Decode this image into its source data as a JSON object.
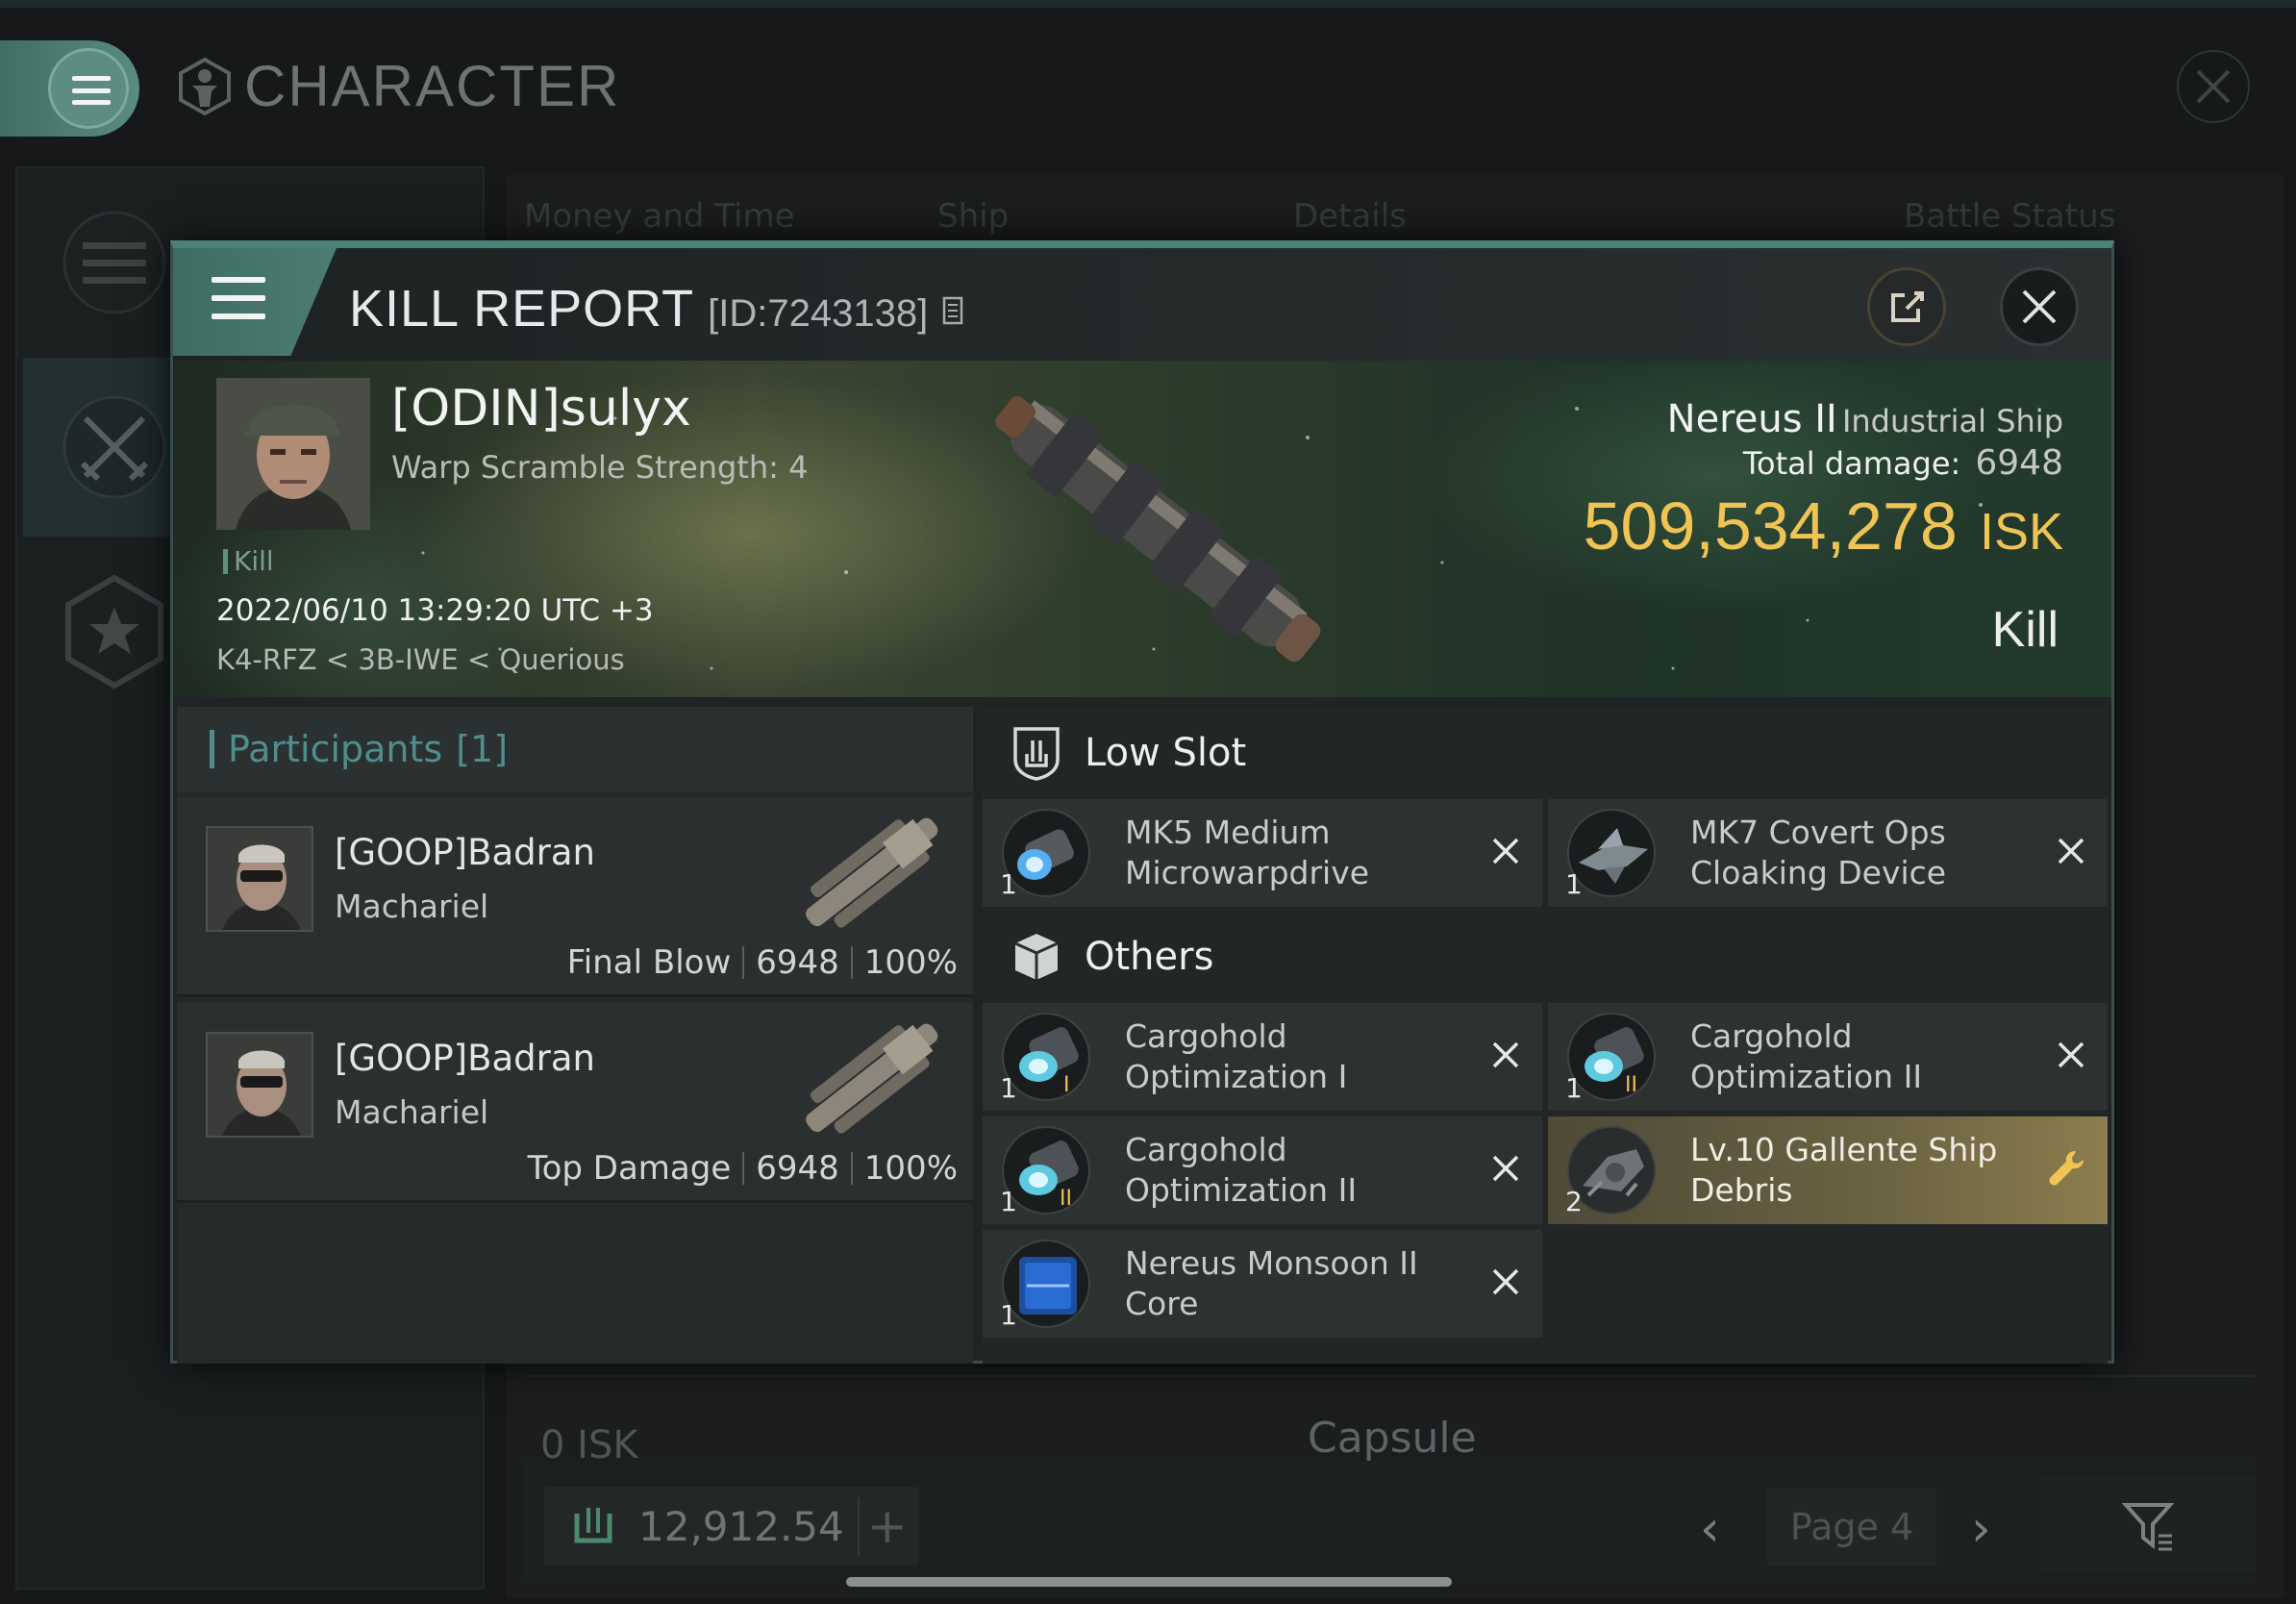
{
  "background_window": {
    "title": "CHARACTER",
    "tabs": [
      "Money and Time",
      "Ship",
      "Details",
      "Battle Status"
    ],
    "row_isk": "0 ISK",
    "row_ship": "Capsule",
    "balance": "12,912.54",
    "page": "Page 4"
  },
  "kill_report": {
    "title": "KILL REPORT",
    "report_id": "[ID:7243138]",
    "victim": {
      "name": "[ODIN]sulyx",
      "subtitle": "Warp Scramble Strength: 4",
      "tag": "Kill",
      "datetime": "2022/06/10 13:29:20 UTC +3",
      "location": "K4-RFZ < 3B-IWE < Querious",
      "ship_name": "Nereus II",
      "ship_class": "Industrial Ship",
      "damage_label": "Total damage:",
      "damage_value": "6948",
      "isk_value": "509,534,278",
      "isk_unit": "ISK",
      "result": "Kill"
    },
    "participants": {
      "header_label": "Participants",
      "header_count": "[1]",
      "rows": [
        {
          "name": "[GOOP]Badran",
          "ship": "Machariel",
          "role": "Final Blow",
          "damage": "6948",
          "percent": "100%"
        },
        {
          "name": "[GOOP]Badran",
          "ship": "Machariel",
          "role": "Top Damage",
          "damage": "6948",
          "percent": "100%"
        }
      ]
    },
    "sections": {
      "low_slot": {
        "label": "Low Slot",
        "items": [
          {
            "name": "MK5 Medium Microwarpdrive",
            "qty": "1",
            "icon": "microwarpdrive-icon"
          },
          {
            "name": "MK7 Covert Ops Cloaking Device",
            "qty": "1",
            "icon": "cloaking-device-icon"
          }
        ]
      },
      "others": {
        "label": "Others",
        "items": [
          {
            "name": "Cargohold Optimization I",
            "qty": "1",
            "icon": "cargohold-optimization-icon",
            "tier": "I"
          },
          {
            "name": "Cargohold Optimization II",
            "qty": "1",
            "icon": "cargohold-optimization-icon",
            "tier": "II"
          },
          {
            "name": "Cargohold Optimization II",
            "qty": "1",
            "icon": "cargohold-optimization-icon",
            "tier": "II"
          },
          {
            "name": "Lv.10 Gallente Ship Debris",
            "qty": "2",
            "icon": "ship-debris-icon",
            "highlight": true
          },
          {
            "name": "Nereus Monsoon II Core",
            "qty": "1",
            "icon": "ship-core-icon"
          }
        ]
      }
    }
  },
  "colors": {
    "accent_teal": "#4a8478",
    "isk_gold": "#f0c454",
    "highlight_gold": "#8c7d4e"
  }
}
